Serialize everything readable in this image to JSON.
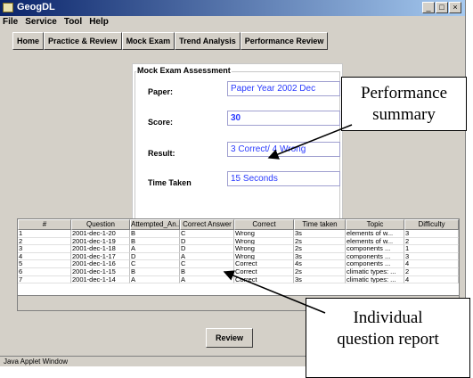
{
  "window": {
    "title": "GeogDL",
    "controls": [
      "_",
      "□",
      "×"
    ]
  },
  "menu": [
    "File",
    "Service",
    "Tool",
    "Help"
  ],
  "tabs": [
    "Home",
    "Practice & Review",
    "Mock Exam",
    "Trend Analysis",
    "Performance Review"
  ],
  "panel": {
    "title": "Mock Exam Assessment",
    "paper_label": "Paper:",
    "paper_value": "Paper Year 2002 Dec",
    "score_label": "Score:",
    "score_value": "30",
    "result_label": "Result:",
    "result_value": "3 Correct/  4 Wrong",
    "time_label": "Time Taken",
    "time_value": "15 Seconds"
  },
  "table": {
    "columns": [
      "#",
      "Question",
      "Attempted_An...",
      "Correct Answer",
      "Correct",
      "Time taken",
      "Topic",
      "Difficulty"
    ],
    "rows": [
      [
        "1",
        "2001-dec-1-20",
        "B",
        "C",
        "Wrong",
        "3s",
        "elements of w...",
        "3"
      ],
      [
        "2",
        "2001-dec-1-19",
        "B",
        "D",
        "Wrong",
        "2s",
        "elements of w...",
        "2"
      ],
      [
        "3",
        "2001-dec-1-18",
        "A",
        "D",
        "Wrong",
        "2s",
        "components ...",
        "1"
      ],
      [
        "4",
        "2001-dec-1-17",
        "D",
        "A",
        "Wrong",
        "3s",
        "components ...",
        "3"
      ],
      [
        "5",
        "2001-dec-1-16",
        "C",
        "C",
        "Correct",
        "4s",
        "components ...",
        "4"
      ],
      [
        "6",
        "2001-dec-1-15",
        "B",
        "B",
        "Correct",
        "2s",
        "climatic types: ...",
        "2"
      ],
      [
        "7",
        "2001-dec-1-14",
        "A",
        "A",
        "Correct",
        "3s",
        "climatic types: ...",
        "4"
      ]
    ]
  },
  "review_button": "Review",
  "status_bar": "Java Applet Window",
  "callouts": {
    "performance_line1": "Performance",
    "performance_line2": "summary",
    "individual_line1": "Individual",
    "individual_line2": "question report"
  }
}
